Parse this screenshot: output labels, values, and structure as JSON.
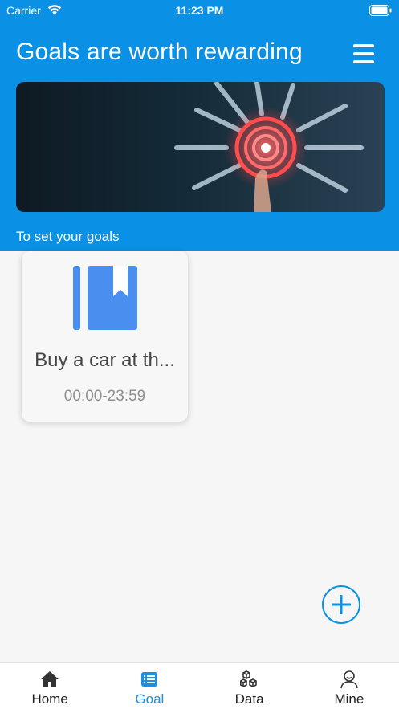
{
  "status_bar": {
    "carrier": "Carrier",
    "time": "11:23 PM"
  },
  "header": {
    "title": "Goals are worth rewarding",
    "subtitle": "To set your goals"
  },
  "goals": [
    {
      "title": "Buy a car at th...",
      "time": "00:00-23:59",
      "icon": "book-icon"
    }
  ],
  "tabs": [
    {
      "label": "Home",
      "icon": "home-icon",
      "active": false
    },
    {
      "label": "Goal",
      "icon": "list-icon",
      "active": true
    },
    {
      "label": "Data",
      "icon": "cubes-icon",
      "active": false
    },
    {
      "label": "Mine",
      "icon": "user-icon",
      "active": false
    }
  ],
  "colors": {
    "primary": "#0a90e4",
    "background": "#f6f6f6",
    "book": "#4a8ff0",
    "active_tab": "#1a8fe3"
  }
}
